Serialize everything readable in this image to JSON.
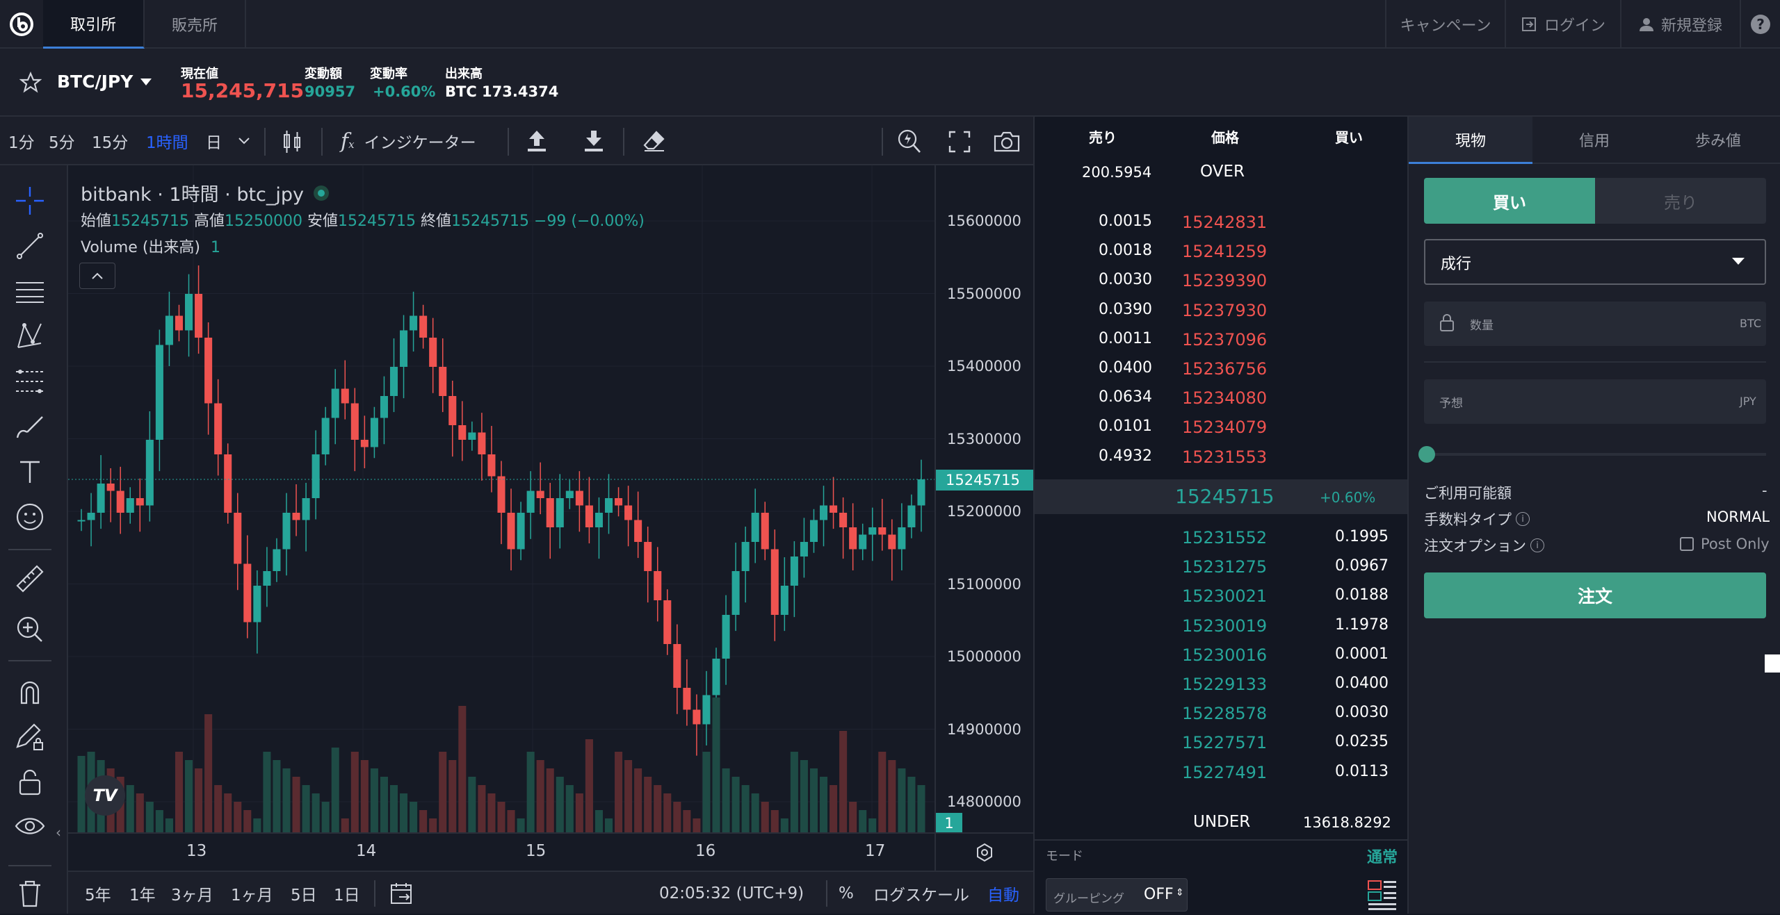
{
  "nav": {
    "tab_exchange": "取引所",
    "tab_store": "販売所",
    "campaign": "キャンペーン",
    "login": "ログイン",
    "signup": "新規登録",
    "help": "?"
  },
  "ticker": {
    "pair": "BTC/JPY",
    "price_label": "現在値",
    "price": "15,245,715",
    "change_label": "変動額",
    "change": "90957",
    "rate_label": "変動率",
    "rate": "+0.60%",
    "volume_label": "出来高",
    "volume": "BTC 173.4374"
  },
  "toolbar": {
    "tf1": "1分",
    "tf5": "5分",
    "tf15": "15分",
    "tf1h": "1時間",
    "day": "日",
    "indicator": "インジケーター"
  },
  "legend": {
    "title": "bitbank · 1時間 · btc_jpy",
    "open_label": "始値",
    "open": "15245715",
    "high_label": "高値",
    "high": "15250000",
    "low_label": "安値",
    "low": "15245715",
    "close_label": "終値",
    "close": "15245715 −99 (−0.00%)",
    "volume_label": "Volume (出来高)",
    "volume": "1"
  },
  "price_axis": [
    "15600000",
    "15500000",
    "15400000",
    "15300000",
    "15200000",
    "15100000",
    "15000000",
    "14900000",
    "14800000"
  ],
  "price_tag": "15245715",
  "vol_tag": "1",
  "time_axis": [
    "13",
    "14",
    "15",
    "16",
    "17"
  ],
  "bottom": {
    "r5y": "5年",
    "r1y": "1年",
    "r3m": "3ヶ月",
    "r1m": "1ヶ月",
    "r5d": "5日",
    "r1d": "1日",
    "clock": "02:05:32 (UTC+9)",
    "pct": "%",
    "log": "ログスケール",
    "auto": "自動"
  },
  "orderbook": {
    "h_sell": "売り",
    "h_price": "価格",
    "h_buy": "買い",
    "over_qty": "200.5954",
    "over": "OVER",
    "asks": [
      {
        "qty": "0.0015",
        "price": "15242831"
      },
      {
        "qty": "0.0018",
        "price": "15241259"
      },
      {
        "qty": "0.0030",
        "price": "15239390"
      },
      {
        "qty": "0.0390",
        "price": "15237930"
      },
      {
        "qty": "0.0011",
        "price": "15237096"
      },
      {
        "qty": "0.0400",
        "price": "15236756"
      },
      {
        "qty": "0.0634",
        "price": "15234080"
      },
      {
        "qty": "0.0101",
        "price": "15234079"
      },
      {
        "qty": "0.4932",
        "price": "15231553"
      }
    ],
    "mid": "15245715",
    "mid_rate": "+0.60%",
    "bids": [
      {
        "price": "15231552",
        "qty": "0.1995"
      },
      {
        "price": "15231275",
        "qty": "0.0967"
      },
      {
        "price": "15230021",
        "qty": "0.0188"
      },
      {
        "price": "15230019",
        "qty": "1.1978"
      },
      {
        "price": "15230016",
        "qty": "0.0001"
      },
      {
        "price": "15229133",
        "qty": "0.0400"
      },
      {
        "price": "15228578",
        "qty": "0.0030"
      },
      {
        "price": "15227571",
        "qty": "0.0235"
      },
      {
        "price": "15227491",
        "qty": "0.0113"
      }
    ],
    "under": "UNDER",
    "under_qty": "13618.8292",
    "mode_label": "モード",
    "mode_value": "通常",
    "grouping_label": "グルーピング",
    "grouping_value": "OFF"
  },
  "order": {
    "tab_spot": "現物",
    "tab_margin": "信用",
    "tab_tape": "歩み値",
    "buy": "買い",
    "sell": "売り",
    "type": "成行",
    "qty_placeholder": "数量",
    "qty_unit": "BTC",
    "est_label": "予想",
    "est_unit": "JPY",
    "available_label": "ご利用可能額",
    "available": "-",
    "fee_label": "手数料タイプ",
    "fee": "NORMAL",
    "option_label": "注文オプション",
    "postonly": "Post Only",
    "submit": "注文"
  },
  "colors": {
    "up": "#26a69a",
    "down": "#ef5350",
    "accent": "#3c7fd8",
    "buy_btn": "#3f9e86"
  }
}
